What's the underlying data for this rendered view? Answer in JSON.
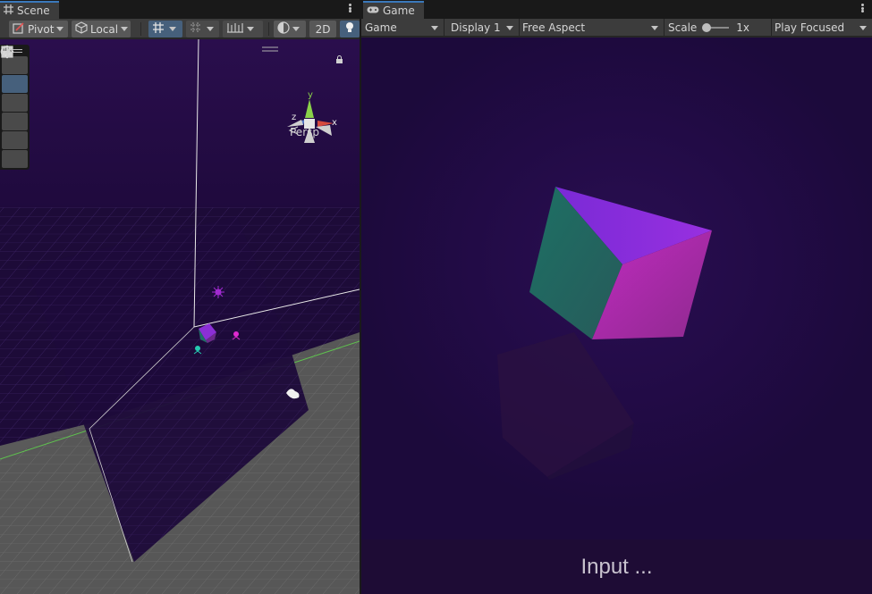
{
  "scene": {
    "tab_title": "Scene",
    "toolbar": {
      "pivot_label": "Pivot",
      "local_label": "Local",
      "mode_2d_label": "2D"
    },
    "tools": [
      {
        "name": "hand-tool",
        "icon": "hand-icon",
        "active": false
      },
      {
        "name": "move-tool",
        "icon": "move-icon",
        "active": true
      },
      {
        "name": "rotate-tool",
        "icon": "rotate-icon",
        "active": false
      },
      {
        "name": "scale-tool",
        "icon": "scale-icon",
        "active": false
      },
      {
        "name": "rect-tool",
        "icon": "rect-icon",
        "active": false
      },
      {
        "name": "transform-tool",
        "icon": "transform-icon",
        "active": false
      }
    ],
    "gizmo": {
      "x_label": "x",
      "y_label": "y",
      "z_label": "z"
    },
    "projection_label": "Persp"
  },
  "game": {
    "tab_title": "Game",
    "toolbar": {
      "view_mode": "Game",
      "display": "Display 1",
      "aspect": "Free Aspect",
      "scale_label": "Scale",
      "scale_value": "1x",
      "play_mode": "Play Focused"
    },
    "input_text": "Input ..."
  },
  "colors": {
    "accent": "#3a79bb",
    "game_background": "#220b46",
    "cube_top": "#8a2fd6",
    "cube_left": "#1f6e66",
    "cube_right": "#b524a6"
  }
}
